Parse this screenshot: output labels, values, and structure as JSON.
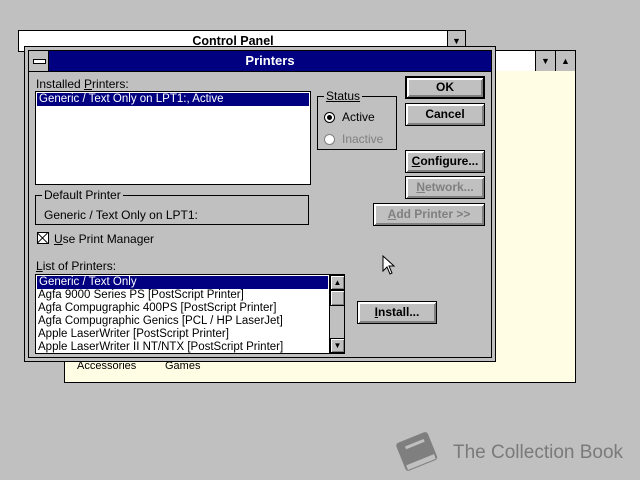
{
  "control_panel": {
    "title": "Control Panel"
  },
  "print_manager": {
    "groups": [
      "Accessories",
      "Games"
    ]
  },
  "dialog": {
    "title": "Printers",
    "installed_label_pre": "Installed ",
    "installed_label_u": "P",
    "installed_label_post": "rinters:",
    "installed_printers": [
      "Generic / Text Only on LPT1:, Active"
    ],
    "status": {
      "title": "Status",
      "active_label": "Active",
      "inactive_label": "Inactive",
      "selected": "Active"
    },
    "default_printer": {
      "title": "Default Printer",
      "value": "Generic / Text Only on LPT1:"
    },
    "use_print_manager": {
      "u": "U",
      "rest": "se Print Manager",
      "checked": true
    },
    "list_label_pre": "",
    "list_label_u": "L",
    "list_label_post": "ist of Printers:",
    "printers_list": [
      "Generic / Text Only",
      "Agfa 9000 Series PS [PostScript Printer]",
      "Agfa Compugraphic 400PS [PostScript Printer]",
      "Agfa Compugraphic Genics [PCL / HP LaserJet]",
      "Apple LaserWriter [PostScript Printer]",
      "Apple LaserWriter II NT/NTX [PostScript Printer]"
    ],
    "buttons": {
      "ok": "OK",
      "cancel": "Cancel",
      "configure_u": "C",
      "configure_rest": "onfigure...",
      "network_u": "N",
      "network_rest": "etwork...",
      "add_printer_u": "A",
      "add_printer_rest": "dd Printer >>",
      "install_u": "I",
      "install_rest": "nstall..."
    }
  },
  "watermark": {
    "text": "The Collection Book",
    "icon": "book-icon"
  }
}
